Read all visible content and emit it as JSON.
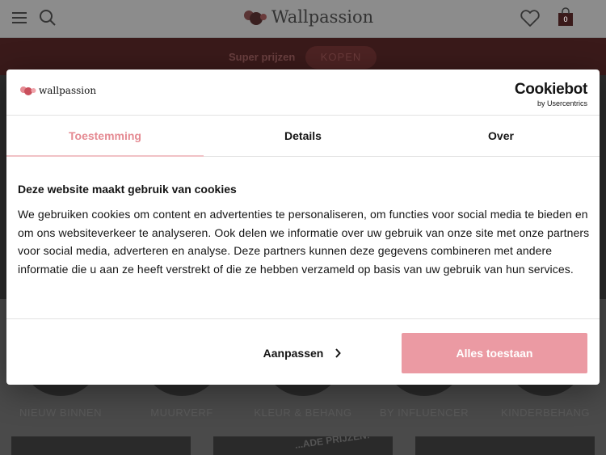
{
  "site": {
    "brand": "Wallpassion",
    "cart_count": "0"
  },
  "promo": {
    "text": "Super prijzen",
    "button": "KOPEN"
  },
  "categories": [
    {
      "label": "NIEUW BINNEN"
    },
    {
      "label": "MUURVERF"
    },
    {
      "label": "KLEUR & BEHANG"
    },
    {
      "label": "BY INFLUENCER"
    },
    {
      "label": "KINDERBEHANG"
    }
  ],
  "tiles": {
    "middle_label": "...ADE PRIJZEN!"
  },
  "cookie_dialog": {
    "brand": "wallpassion",
    "provider": {
      "name": "Cookiebot",
      "sub": "by Usercentrics"
    },
    "tabs": [
      {
        "label": "Toestemming",
        "active": true
      },
      {
        "label": "Details",
        "active": false
      },
      {
        "label": "Over",
        "active": false
      }
    ],
    "title": "Deze website maakt gebruik van cookies",
    "body": "We gebruiken cookies om content en advertenties te personaliseren, om functies voor social media te bieden en om ons websiteverkeer te analyseren. Ook delen we informatie over uw gebruik van onze site met onze partners voor social media, adverteren en analyse. Deze partners kunnen deze gegevens combineren met andere informatie die u aan ze heeft verstrekt of die ze hebben verzameld op basis van uw gebruik van hun services.",
    "customize_label": "Aanpassen",
    "allow_label": "Alles toestaan"
  },
  "colors": {
    "accent_pink": "#eb9aa3",
    "tab_active": "#e58a92"
  },
  "icons": [
    "menu-icon",
    "search-icon",
    "heart-icon",
    "shopping-bag-icon",
    "chevron-right-icon"
  ]
}
